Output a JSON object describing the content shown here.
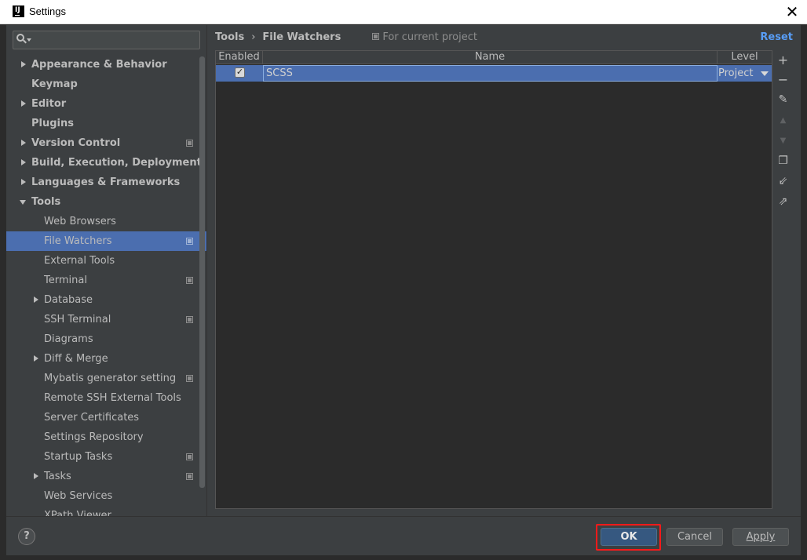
{
  "window": {
    "title": "Settings",
    "close_glyph": "✕",
    "logo_text": "IJ"
  },
  "search": {
    "placeholder": "",
    "value": ""
  },
  "tree": {
    "items": [
      {
        "label": "Appearance & Behavior",
        "level": 0,
        "arrow": "right",
        "bold": true,
        "project": false
      },
      {
        "label": "Keymap",
        "level": 0,
        "arrow": "none",
        "bold": true,
        "project": false
      },
      {
        "label": "Editor",
        "level": 0,
        "arrow": "right",
        "bold": true,
        "project": false
      },
      {
        "label": "Plugins",
        "level": 0,
        "arrow": "none",
        "bold": true,
        "project": false
      },
      {
        "label": "Version Control",
        "level": 0,
        "arrow": "right",
        "bold": true,
        "project": true
      },
      {
        "label": "Build, Execution, Deployment",
        "level": 0,
        "arrow": "right",
        "bold": true,
        "project": false
      },
      {
        "label": "Languages & Frameworks",
        "level": 0,
        "arrow": "right",
        "bold": true,
        "project": false
      },
      {
        "label": "Tools",
        "level": 0,
        "arrow": "down",
        "bold": true,
        "project": false
      },
      {
        "label": "Web Browsers",
        "level": 1,
        "arrow": "none",
        "bold": false,
        "project": false
      },
      {
        "label": "File Watchers",
        "level": 1,
        "arrow": "none",
        "bold": false,
        "project": true,
        "selected": true
      },
      {
        "label": "External Tools",
        "level": 1,
        "arrow": "none",
        "bold": false,
        "project": false
      },
      {
        "label": "Terminal",
        "level": 1,
        "arrow": "none",
        "bold": false,
        "project": true
      },
      {
        "label": "Database",
        "level": 1,
        "arrow": "right",
        "bold": false,
        "project": false
      },
      {
        "label": "SSH Terminal",
        "level": 1,
        "arrow": "none",
        "bold": false,
        "project": true
      },
      {
        "label": "Diagrams",
        "level": 1,
        "arrow": "none",
        "bold": false,
        "project": false
      },
      {
        "label": "Diff & Merge",
        "level": 1,
        "arrow": "right",
        "bold": false,
        "project": false
      },
      {
        "label": "Mybatis generator setting",
        "level": 1,
        "arrow": "none",
        "bold": false,
        "project": true
      },
      {
        "label": "Remote SSH External Tools",
        "level": 1,
        "arrow": "none",
        "bold": false,
        "project": false
      },
      {
        "label": "Server Certificates",
        "level": 1,
        "arrow": "none",
        "bold": false,
        "project": false
      },
      {
        "label": "Settings Repository",
        "level": 1,
        "arrow": "none",
        "bold": false,
        "project": false
      },
      {
        "label": "Startup Tasks",
        "level": 1,
        "arrow": "none",
        "bold": false,
        "project": true
      },
      {
        "label": "Tasks",
        "level": 1,
        "arrow": "right",
        "bold": false,
        "project": true
      },
      {
        "label": "Web Services",
        "level": 1,
        "arrow": "none",
        "bold": false,
        "project": false
      },
      {
        "label": "XPath Viewer",
        "level": 1,
        "arrow": "none",
        "bold": false,
        "project": false,
        "cut": true
      }
    ]
  },
  "breadcrumb": {
    "parent": "Tools",
    "separator": "›",
    "current": "File Watchers",
    "scope": "For current project"
  },
  "reset_label": "Reset",
  "table": {
    "headers": {
      "enabled": "Enabled",
      "name": "Name",
      "level": "Level"
    },
    "rows": [
      {
        "enabled": true,
        "check_glyph": "✓",
        "name": "SCSS",
        "level": "Project"
      }
    ]
  },
  "toolbar": {
    "add": "+",
    "remove": "−",
    "edit": "✎",
    "up": "▲",
    "down": "▼",
    "copy": "❐",
    "import": "⇙",
    "export": "⇗"
  },
  "footer": {
    "help": "?",
    "ok": "OK",
    "cancel": "Cancel",
    "apply": "Apply"
  },
  "colors": {
    "selection": "#4b6eaf",
    "background": "#3c3f41",
    "accent_link": "#589df6",
    "highlight_box": "#ff1a1a"
  }
}
